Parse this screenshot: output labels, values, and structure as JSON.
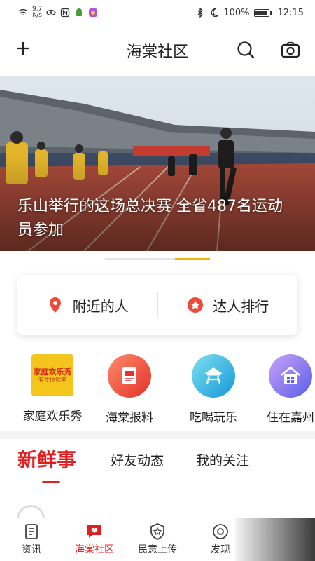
{
  "status_bar": {
    "speed_value": "9.7",
    "speed_unit": "K/s",
    "battery": "100%",
    "battery_level": 1.0,
    "time": "12:15"
  },
  "header": {
    "title": "海棠社区"
  },
  "banner": {
    "caption": "乐山举行的这场总决赛 全省487名运动员参加",
    "pager_active_index": 2,
    "pager_count": 3
  },
  "nearby_card": {
    "nearby_label": "附近的人",
    "ranking_label": "达人排行"
  },
  "categories": [
    {
      "label": "家庭欢乐秀",
      "poster_line1": "家庭欢乐秀",
      "poster_line2": "有才你就来"
    },
    {
      "label": "海棠报料"
    },
    {
      "label": "吃喝玩乐"
    },
    {
      "label": "住在嘉州"
    }
  ],
  "tabs": [
    {
      "label": "新鲜事"
    },
    {
      "label": "好友动态"
    },
    {
      "label": "我的关注"
    }
  ],
  "bottom_nav": [
    {
      "label": "资讯"
    },
    {
      "label": "海棠社区"
    },
    {
      "label": "民意上传"
    },
    {
      "label": "发现"
    }
  ],
  "colors": {
    "accent_red": "#e02020",
    "pager_active": "#f3b400"
  }
}
